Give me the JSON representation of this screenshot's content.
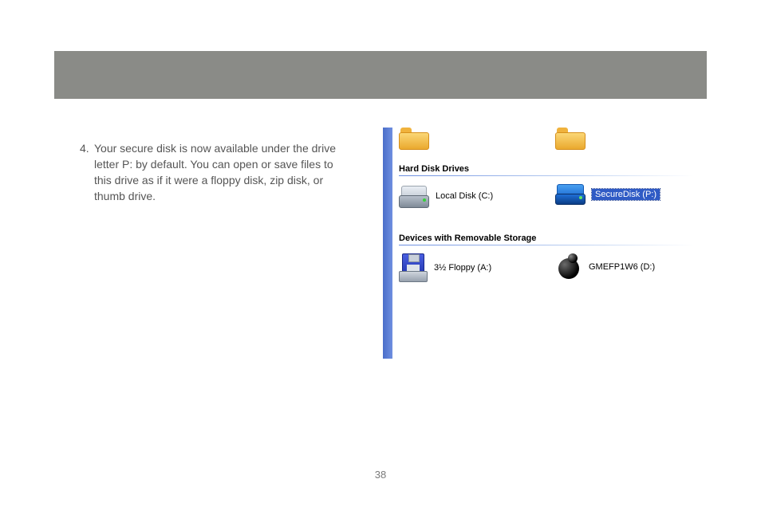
{
  "instruction": {
    "number": "4.",
    "text": "Your secure disk is now available under the drive letter P: by default.  You can open or save files to this drive as if it were a floppy disk, zip disk, or thumb drive."
  },
  "page_number": "38",
  "explorer": {
    "group1_title": "Hard Disk Drives",
    "local_disk_label": "Local Disk (C:)",
    "secure_disk_label": "SecureDisk (P:)",
    "group2_title": "Devices with Removable Storage",
    "floppy_label": "3½ Floppy (A:)",
    "device_label": "GMEFP1W6 (D:)"
  }
}
